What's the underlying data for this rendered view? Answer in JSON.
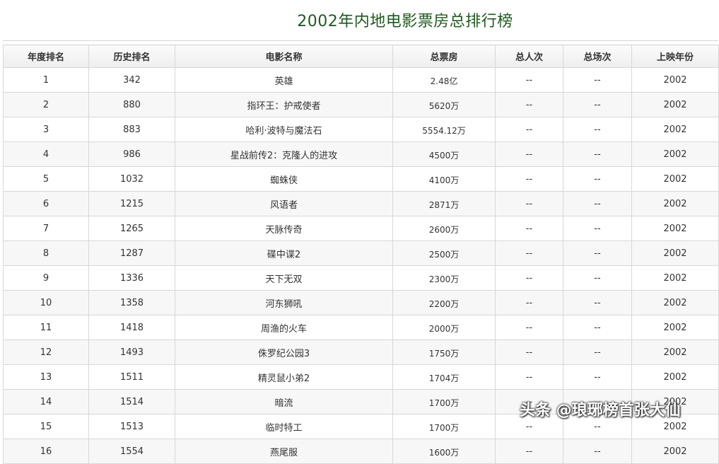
{
  "page": {
    "title": "2002年内地电影票房总排行榜"
  },
  "table": {
    "columns": [
      "年度排名",
      "历史排名",
      "电影名称",
      "总票房",
      "总人次",
      "总场次",
      "上映年份"
    ],
    "rows": [
      {
        "year_rank": "1",
        "hist_rank": "342",
        "film": "英雄",
        "box": "2.48亿",
        "viewers": "--",
        "shows": "--",
        "year": "2002"
      },
      {
        "year_rank": "2",
        "hist_rank": "880",
        "film": "指环王：护戒使者",
        "box": "5620万",
        "viewers": "--",
        "shows": "--",
        "year": "2002"
      },
      {
        "year_rank": "3",
        "hist_rank": "883",
        "film": "哈利·波特与魔法石",
        "box": "5554.12万",
        "viewers": "--",
        "shows": "--",
        "year": "2002"
      },
      {
        "year_rank": "4",
        "hist_rank": "986",
        "film": "星战前传2：克隆人的进攻",
        "box": "4500万",
        "viewers": "--",
        "shows": "--",
        "year": "2002"
      },
      {
        "year_rank": "5",
        "hist_rank": "1032",
        "film": "蜘蛛侠",
        "box": "4100万",
        "viewers": "--",
        "shows": "--",
        "year": "2002"
      },
      {
        "year_rank": "6",
        "hist_rank": "1215",
        "film": "风语者",
        "box": "2871万",
        "viewers": "--",
        "shows": "--",
        "year": "2002"
      },
      {
        "year_rank": "7",
        "hist_rank": "1265",
        "film": "天脉传奇",
        "box": "2600万",
        "viewers": "--",
        "shows": "--",
        "year": "2002"
      },
      {
        "year_rank": "8",
        "hist_rank": "1287",
        "film": "碟中谍2",
        "box": "2500万",
        "viewers": "--",
        "shows": "--",
        "year": "2002"
      },
      {
        "year_rank": "9",
        "hist_rank": "1336",
        "film": "天下无双",
        "box": "2300万",
        "viewers": "--",
        "shows": "--",
        "year": "2002"
      },
      {
        "year_rank": "10",
        "hist_rank": "1358",
        "film": "河东狮吼",
        "box": "2200万",
        "viewers": "--",
        "shows": "--",
        "year": "2002"
      },
      {
        "year_rank": "11",
        "hist_rank": "1418",
        "film": "周渔的火车",
        "box": "2000万",
        "viewers": "--",
        "shows": "--",
        "year": "2002"
      },
      {
        "year_rank": "12",
        "hist_rank": "1493",
        "film": "侏罗纪公园3",
        "box": "1750万",
        "viewers": "--",
        "shows": "--",
        "year": "2002"
      },
      {
        "year_rank": "13",
        "hist_rank": "1511",
        "film": "精灵鼠小弟2",
        "box": "1704万",
        "viewers": "--",
        "shows": "--",
        "year": "2002"
      },
      {
        "year_rank": "14",
        "hist_rank": "1514",
        "film": "暗流",
        "box": "1700万",
        "viewers": "--",
        "shows": "--",
        "year": "2002"
      },
      {
        "year_rank": "15",
        "hist_rank": "1513",
        "film": "临时特工",
        "box": "1700万",
        "viewers": "--",
        "shows": "--",
        "year": "2002"
      },
      {
        "year_rank": "16",
        "hist_rank": "1554",
        "film": "燕尾服",
        "box": "1600万",
        "viewers": "--",
        "shows": "--",
        "year": "2002"
      }
    ]
  },
  "watermark": {
    "text": "头条 @琅琊榜首张大仙"
  },
  "colors": {
    "title": "#1f5a1f",
    "film_link": "#2a6a9c",
    "border": "#d7d7d7"
  }
}
